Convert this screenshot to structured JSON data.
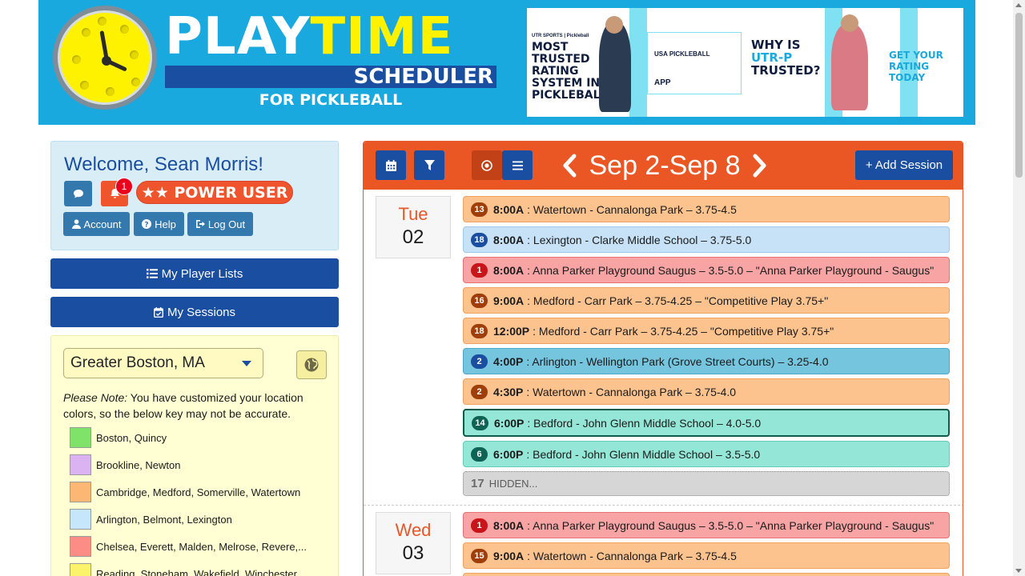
{
  "banner": {
    "logo_word1": "PLAY",
    "logo_word2": "TIME",
    "logo_sub": "SCHEDULER",
    "logo_sub2": "FOR PICKLEBALL",
    "ad": {
      "headline1": "MOST TRUSTED RATING SYSTEM IN PICKLEBALL",
      "headline2a": "WHY IS ",
      "headline2b": "UTR-P",
      "headline2c": " TRUSTED?",
      "cta": "GET YOUR RATING TODAY",
      "brand": "UTR SPORTS | Pickleball",
      "app_label": "APP",
      "usa_label": "USA PICKLEBALL"
    }
  },
  "sidebar": {
    "welcome": "Welcome, Sean Morris!",
    "notification_count": "1",
    "power_user": "★★ POWER USER",
    "account_label": "Account",
    "help_label": "Help",
    "logout_label": "Log Out",
    "player_lists_label": "My Player Lists",
    "sessions_label": "My Sessions",
    "location": "Greater Boston, MA",
    "note_em": "Please Note:",
    "note_text": " You have customized your location colors, so the below key may not be accurate.",
    "key": [
      {
        "label": "Boston, Quincy",
        "color": "#7fe36a"
      },
      {
        "label": "Brookline, Newton",
        "color": "#dcb3f2"
      },
      {
        "label": "Cambridge, Medford, Somerville, Watertown",
        "color": "#fcb774"
      },
      {
        "label": "Arlington, Belmont, Lexington",
        "color": "#c6e6fb"
      },
      {
        "label": "Chelsea, Everett, Malden, Melrose, Revere,...",
        "color": "#fb8c86"
      },
      {
        "label": "Reading, Stoneham, Wakefield, Winchester, ...",
        "color": "#fbf46a"
      }
    ]
  },
  "calendar": {
    "range": "Sep 2-Sep 8",
    "add_label": "+ Add Session",
    "days": [
      {
        "dow": "Tue",
        "num": "02",
        "sessions": [
          {
            "count": "13",
            "time": "8:00A",
            "text": " : Watertown - Cannalonga Park – 3.75-4.5",
            "style": "orange"
          },
          {
            "count": "18",
            "time": "8:00A",
            "text": " : Lexington - Clarke Middle School – 3.75-5.0",
            "style": "lblue"
          },
          {
            "count": "1",
            "time": "8:00A",
            "text": " : Anna Parker Playground Saugus – 3.5-5.0 – \"Anna Parker Playground - Saugus\"",
            "style": "red"
          },
          {
            "count": "16",
            "time": "9:00A",
            "text": " : Medford - Carr Park – 3.75-4.25 – \"Competitive Play 3.75+\"",
            "style": "orange"
          },
          {
            "count": "18",
            "time": "12:00P",
            "text": " : Medford - Carr Park – 3.75-4.25 – \"Competitive Play 3.75+\"",
            "style": "orange"
          },
          {
            "count": "2",
            "time": "4:00P",
            "text": " : Arlington - Wellington Park (Grove Street Courts) – 3.25-4.0",
            "style": "mblue"
          },
          {
            "count": "2",
            "time": "4:30P",
            "text": " : Watertown - Cannalonga Park – 3.75-4.0",
            "style": "orange"
          },
          {
            "count": "14",
            "time": "6:00P",
            "text": " : Bedford - John Glenn Middle School – 4.0-5.0",
            "style": "teal sel"
          },
          {
            "count": "6",
            "time": "6:00P",
            "text": " : Bedford - John Glenn Middle School – 3.5-5.0",
            "style": "teal"
          }
        ],
        "hidden_count": "17",
        "hidden_label": "HIDDEN..."
      },
      {
        "dow": "Wed",
        "num": "03",
        "sessions": [
          {
            "count": "1",
            "time": "8:00A",
            "text": " : Anna Parker Playground Saugus – 3.5-5.0 – \"Anna Parker Playground - Saugus\"",
            "style": "red"
          },
          {
            "count": "15",
            "time": "9:00A",
            "text": " : Watertown - Cannalonga Park – 3.75-4.5",
            "style": "orange"
          }
        ]
      }
    ]
  }
}
